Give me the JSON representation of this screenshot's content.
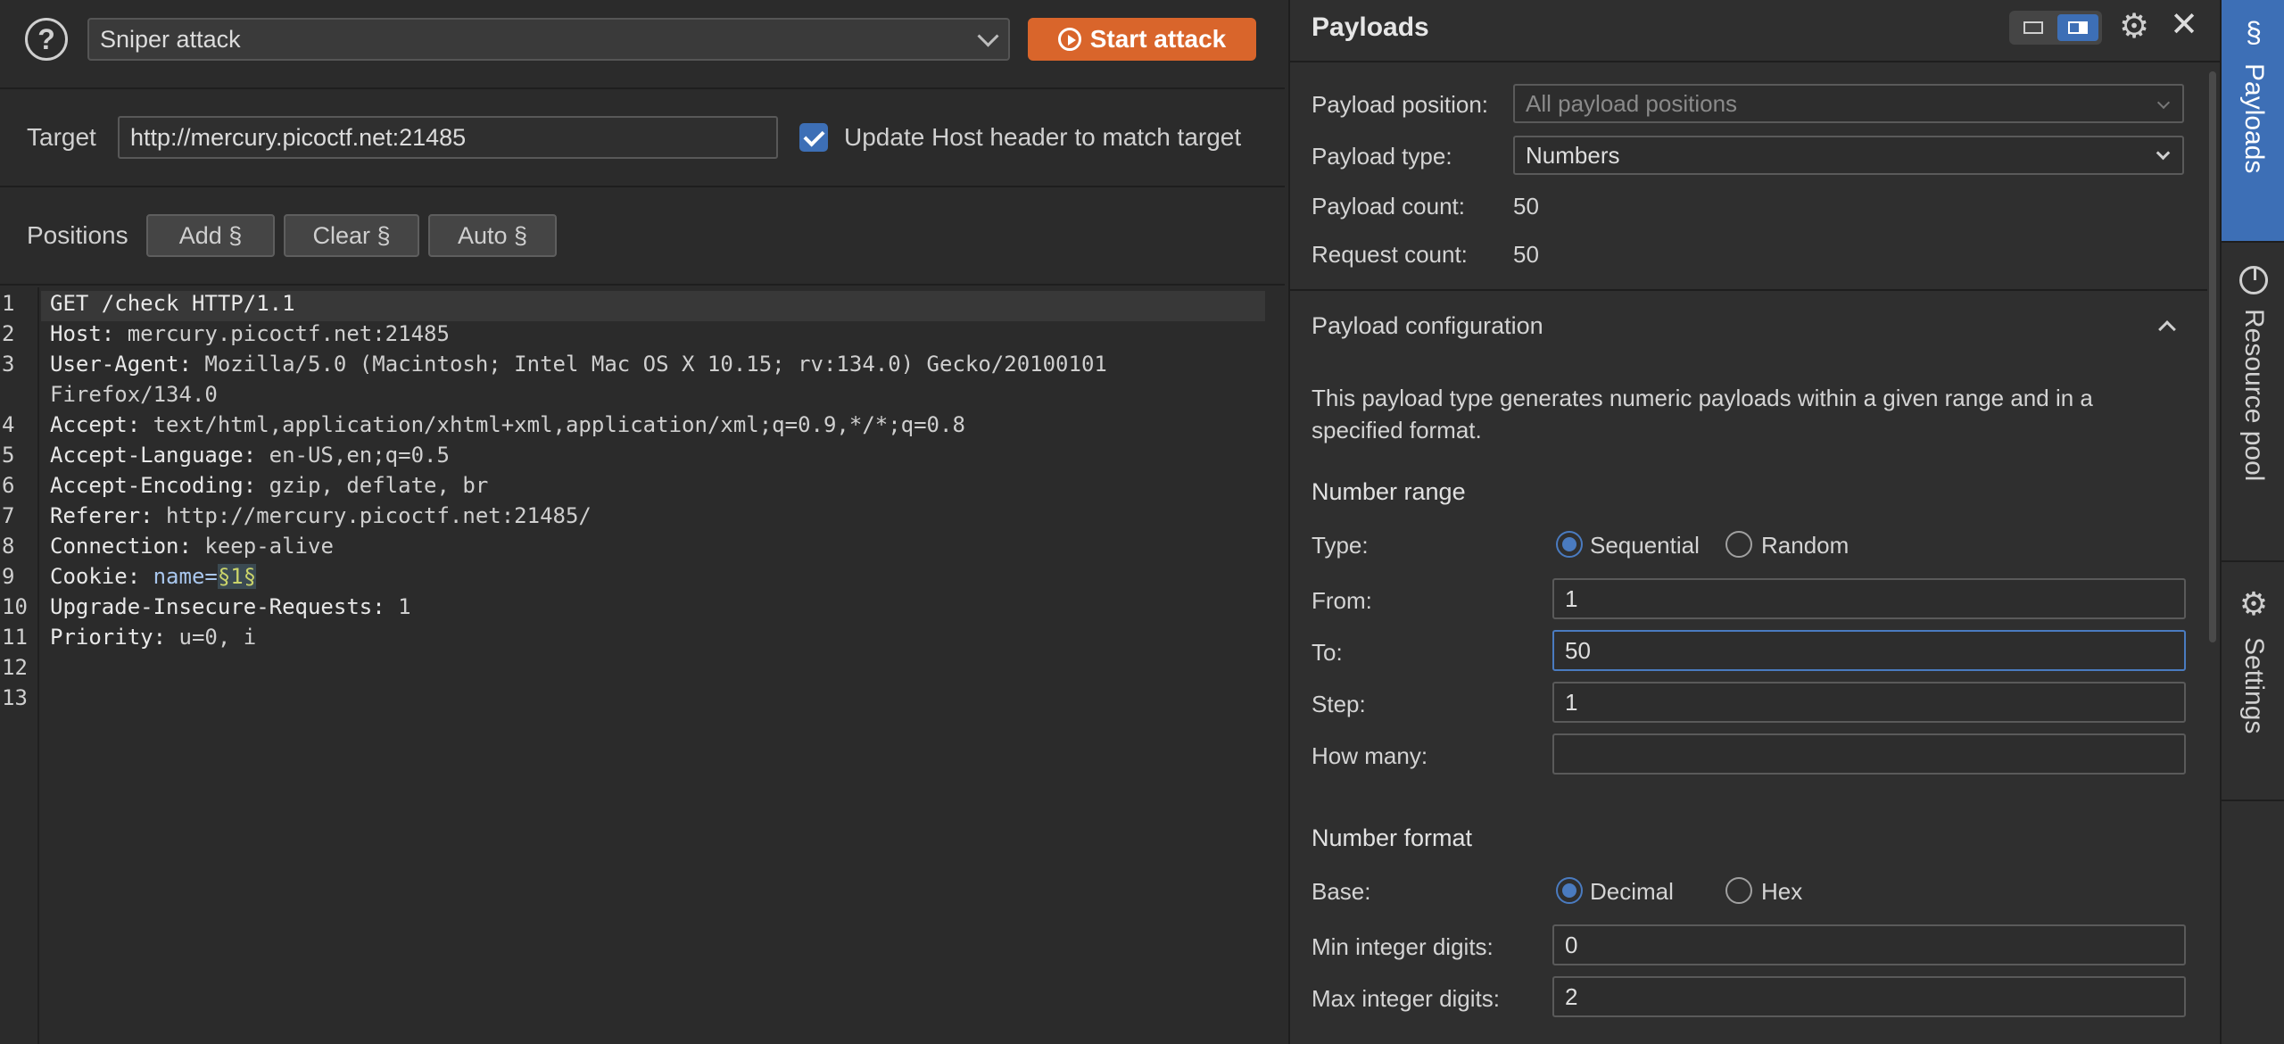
{
  "toolbar": {
    "attack_type": "Sniper attack",
    "start_label": "Start attack"
  },
  "target": {
    "label": "Target",
    "url": "http://mercury.picoctf.net:21485",
    "update_host_label": "Update Host header to match target",
    "update_host_checked": true
  },
  "positions": {
    "label": "Positions",
    "add": "Add §",
    "clear": "Clear §",
    "auto": "Auto §"
  },
  "request": {
    "line_numbers": [
      "1",
      "2",
      "3",
      "",
      "4",
      "5",
      "6",
      "7",
      "8",
      "9",
      "10",
      "11",
      "12",
      "13"
    ],
    "lines": [
      {
        "key": "GET /check HTTP/1.1",
        "val": ""
      },
      {
        "key": "Host:",
        "val": " mercury.picoctf.net:21485"
      },
      {
        "key": "User-Agent:",
        "val": " Mozilla/5.0 (Macintosh; Intel Mac OS X 10.15; rv:134.0) Gecko/20100101"
      },
      {
        "key": "",
        "val": "Firefox/134.0"
      },
      {
        "key": "Accept:",
        "val": " text/html,application/xhtml+xml,application/xml;q=0.9,*/*;q=0.8"
      },
      {
        "key": "Accept-Language:",
        "val": " en-US,en;q=0.5"
      },
      {
        "key": "Accept-Encoding:",
        "val": " gzip, deflate, br"
      },
      {
        "key": "Referer:",
        "val": " http://mercury.picoctf.net:21485/"
      },
      {
        "key": "Connection:",
        "val": " keep-alive"
      },
      {
        "key": "Cookie:",
        "val": " "
      },
      {
        "key": "Upgrade-Insecure-Requests:",
        "val": " 1"
      },
      {
        "key": "Priority:",
        "val": " u=0, i"
      }
    ],
    "cookie_name": "name=",
    "cookie_marker": "§1§"
  },
  "payloads": {
    "title": "Payloads",
    "position_label": "Payload position:",
    "position_value": "All payload positions",
    "type_label": "Payload type:",
    "type_value": "Numbers",
    "count_label": "Payload count:",
    "count_value": "50",
    "request_label": "Request count:",
    "request_value": "50",
    "config_title": "Payload configuration",
    "description": "This payload type generates numeric payloads within a given range and in a specified format.",
    "range_title": "Number range",
    "type_field_label": "Type:",
    "sequential": "Sequential",
    "random": "Random",
    "from_label": "From:",
    "from_value": "1",
    "to_label": "To:",
    "to_value": "50",
    "step_label": "Step:",
    "step_value": "1",
    "how_many_label": "How many:",
    "how_many_value": "",
    "format_title": "Number format",
    "base_label": "Base:",
    "decimal": "Decimal",
    "hex": "Hex",
    "min_int_label": "Min integer digits:",
    "min_int_value": "0",
    "max_int_label": "Max integer digits:",
    "max_int_value": "2"
  },
  "side_tabs": {
    "payloads": "Payloads",
    "resource_pool": "Resource pool",
    "settings": "Settings"
  },
  "colors": {
    "accent": "#d9652b",
    "focus": "#4a7bc0",
    "background": "#2b2b2b"
  }
}
